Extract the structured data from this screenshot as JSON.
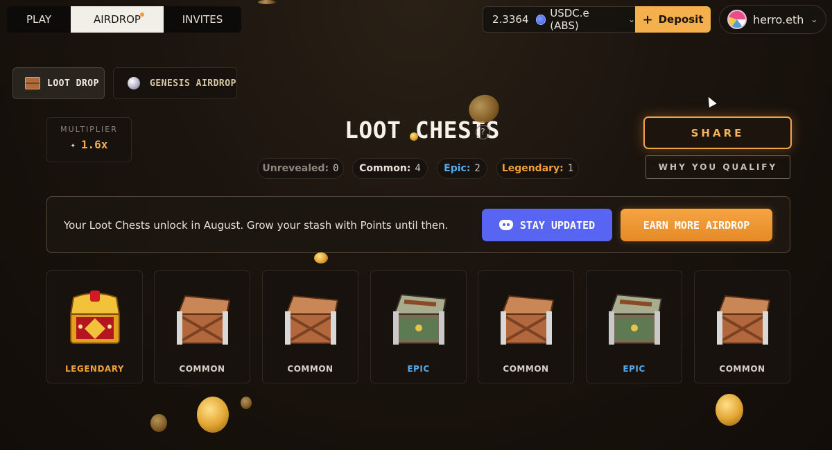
{
  "nav": {
    "tabs": [
      {
        "label": "PLAY"
      },
      {
        "label": "AIRDROP"
      },
      {
        "label": "INVITES"
      }
    ]
  },
  "wallet": {
    "balance": "2.3364",
    "token": "USDC.e (ABS)",
    "deposit_label": "Deposit"
  },
  "profile": {
    "username": "herro.eth"
  },
  "subtabs": [
    {
      "label": "LOOT DROP"
    },
    {
      "label": "GENESIS AIRDROP"
    }
  ],
  "multiplier": {
    "label": "MULTIPLIER",
    "value": "1.6x"
  },
  "title": "LOOT CHESTS",
  "counts": [
    {
      "label": "Unrevealed:",
      "value": "0"
    },
    {
      "label": "Common:",
      "value": "4"
    },
    {
      "label": "Epic:",
      "value": "2"
    },
    {
      "label": "Legendary:",
      "value": "1"
    }
  ],
  "actions": {
    "share_label": "SHARE",
    "qualify_label": "WHY YOU QUALIFY"
  },
  "banner": {
    "text": "Your Loot Chests unlock in August. Grow your stash with Points until then.",
    "discord_label": "STAY UPDATED",
    "earn_label": "EARN MORE AIRDROP"
  },
  "chests": [
    {
      "rarity": "LEGENDARY"
    },
    {
      "rarity": "COMMON"
    },
    {
      "rarity": "COMMON"
    },
    {
      "rarity": "EPIC"
    },
    {
      "rarity": "COMMON"
    },
    {
      "rarity": "EPIC"
    },
    {
      "rarity": "COMMON"
    }
  ],
  "colors": {
    "accent": "#f4b04c",
    "legendary": "#f2a13a",
    "epic": "#57a9e8",
    "discord": "#5865f2"
  }
}
